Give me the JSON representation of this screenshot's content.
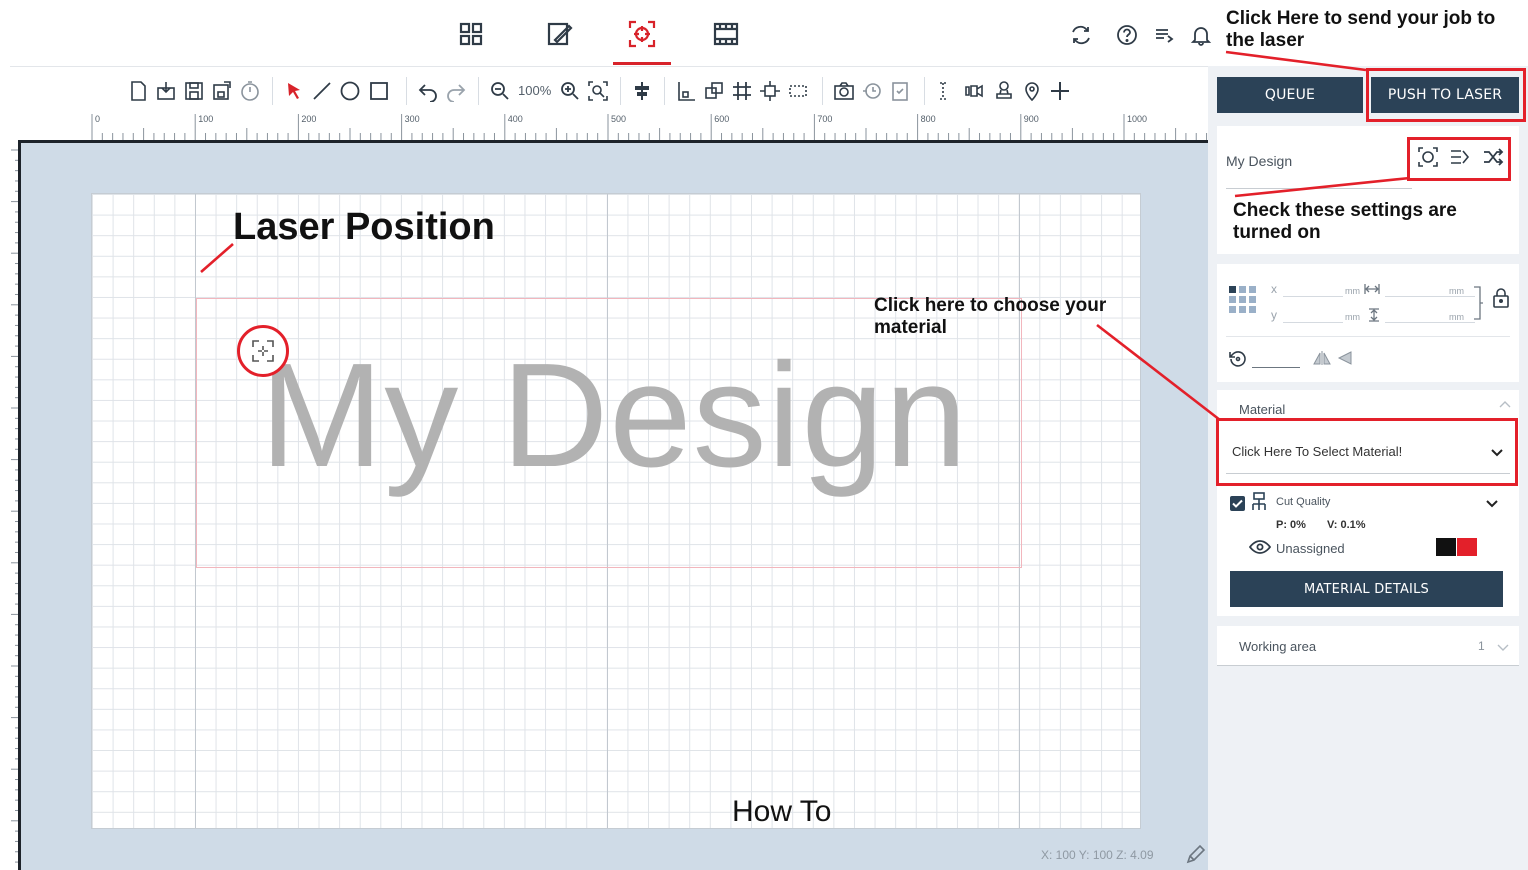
{
  "toolbar": {
    "zoom_level": "100%"
  },
  "ruler": {
    "labels": [
      "0",
      "100",
      "200",
      "300",
      "400",
      "500",
      "600",
      "700",
      "800",
      "900",
      "1000"
    ]
  },
  "canvas": {
    "design_text": "My Design",
    "coords": "X: 100  Y: 100  Z: 4.09"
  },
  "panel": {
    "queue_label": "QUEUE",
    "push_label": "PUSH TO LASER",
    "design_name": "My Design",
    "pos_x_label": "x",
    "pos_y_label": "y",
    "unit": "mm",
    "material_section": "Material",
    "material_select": "Click Here To Select Material!",
    "cut_quality_label": "Cut Quality",
    "power_label": "P: 0%",
    "velocity_label": "V: 0.1%",
    "unassigned_label": "Unassigned",
    "material_details_label": "MATERIAL DETAILS",
    "working_area_label": "Working area",
    "working_area_value": "1"
  },
  "annotations": {
    "push_hint": "Click Here to send your job to the laser",
    "settings_hint": "Check these settings are turned on",
    "laser_hint": "Laser Position",
    "material_hint": "Click here to choose your material"
  },
  "colors": {
    "accent_red": "#e3202a",
    "panel_button": "#2b4257",
    "canvas_bg": "#cfdbe7"
  },
  "caption": "How To"
}
